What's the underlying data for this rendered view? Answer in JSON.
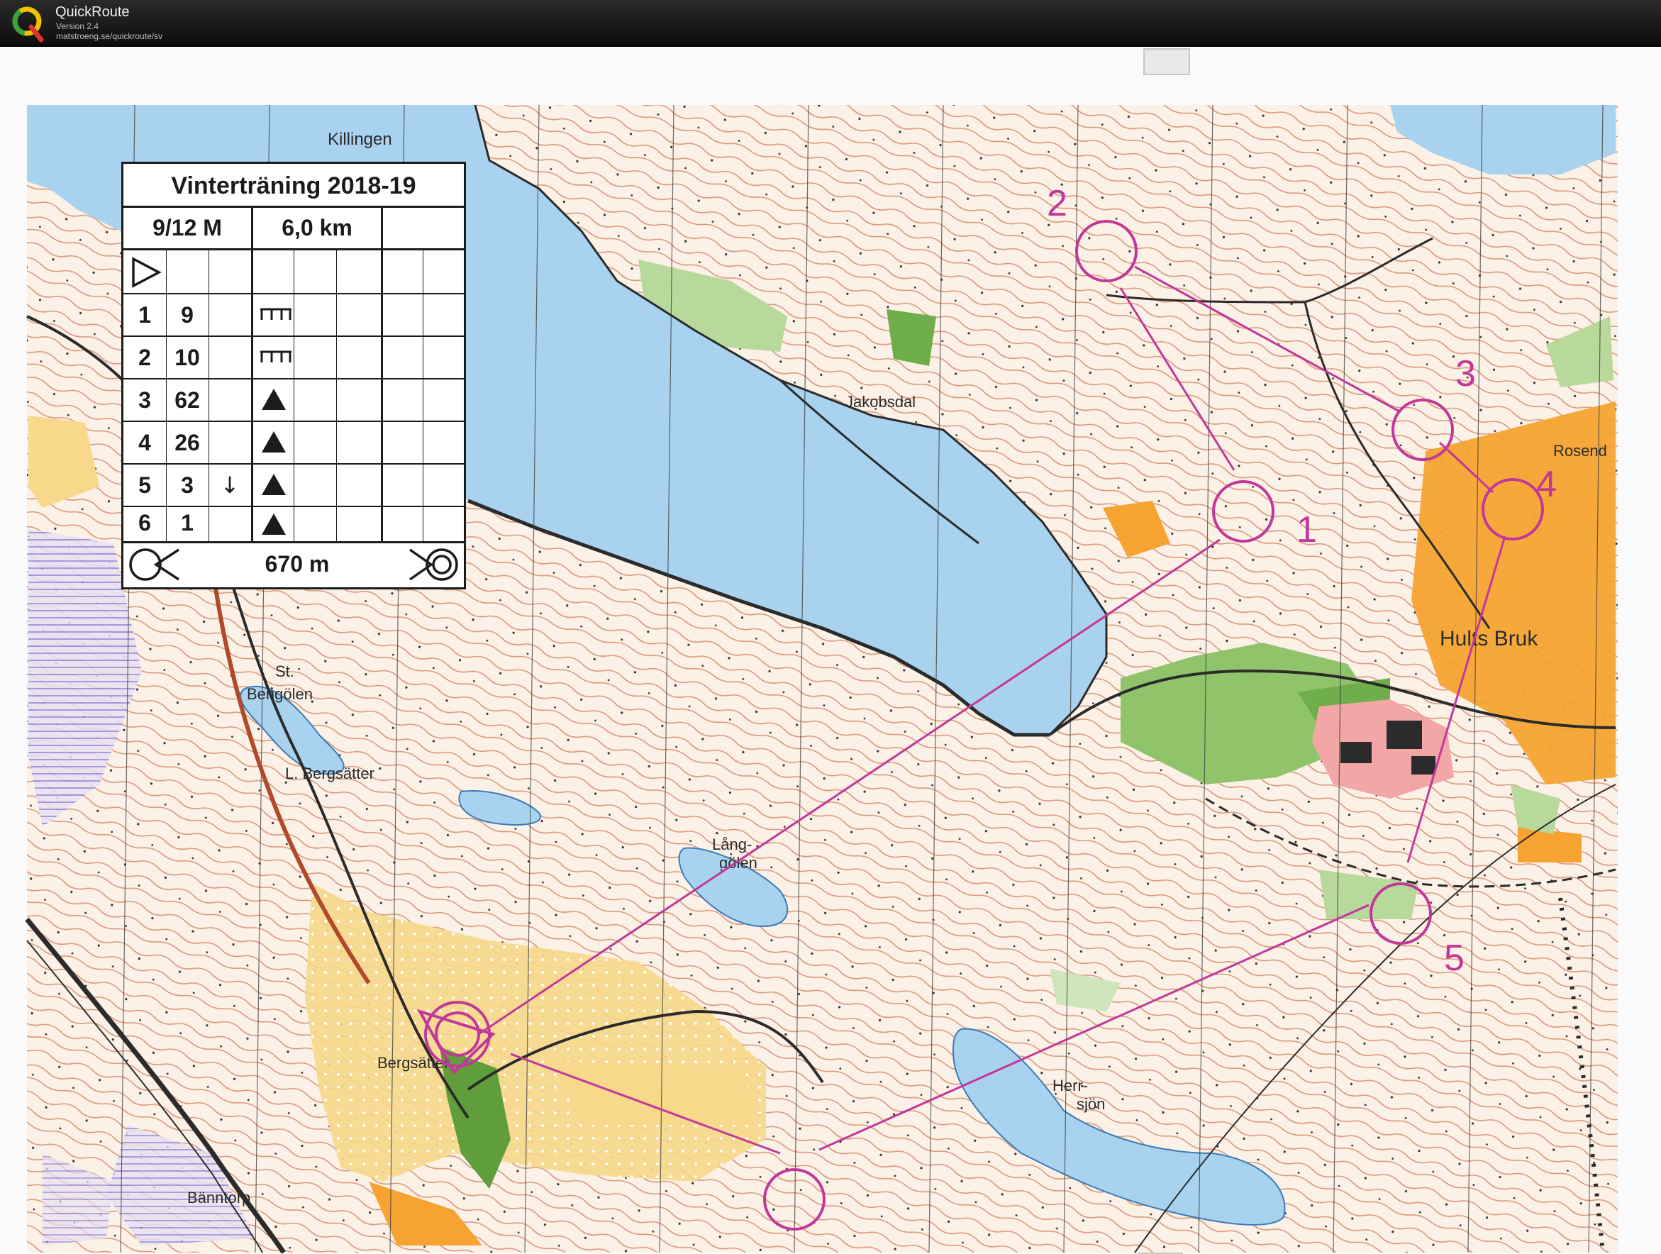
{
  "app": {
    "name": "QuickRoute",
    "version": "Version 2.4",
    "url": "matstroeng.se/quickroute/sv"
  },
  "card": {
    "title": "Vinterträning 2018-19",
    "date": "9/12 M",
    "length": "6,0 km",
    "rows": [
      {
        "num": "1",
        "code": "9",
        "arrow": "",
        "symbol": "comb"
      },
      {
        "num": "2",
        "code": "10",
        "arrow": "",
        "symbol": "comb"
      },
      {
        "num": "3",
        "code": "62",
        "arrow": "",
        "symbol": "triangle"
      },
      {
        "num": "4",
        "code": "26",
        "arrow": "",
        "symbol": "triangle"
      },
      {
        "num": "5",
        "code": "3",
        "arrow": "↓",
        "symbol": "triangle"
      },
      {
        "num": "6",
        "code": "1",
        "arrow": "",
        "symbol": "triangle"
      }
    ],
    "finish_distance": "670 m"
  },
  "map": {
    "place_names": {
      "killingen": "Killingen",
      "jakobsdal": "Jakobsdal",
      "rosendal": "Rosend",
      "hults_bruk": "Hults Bruk",
      "st": "St.",
      "bengolen": "Bengölen",
      "l_bergsatter": "L. Bergsätter",
      "lang": "Lång-",
      "golen": "gölen",
      "herr": "Herr-",
      "sjon": "sjön",
      "bergsatter": "Bergsätter",
      "banntorp": "Bänntorp"
    },
    "controls": [
      "1",
      "2",
      "3",
      "4",
      "5"
    ],
    "course_color": "#c2389a",
    "water_color": "#a9d2ee"
  }
}
